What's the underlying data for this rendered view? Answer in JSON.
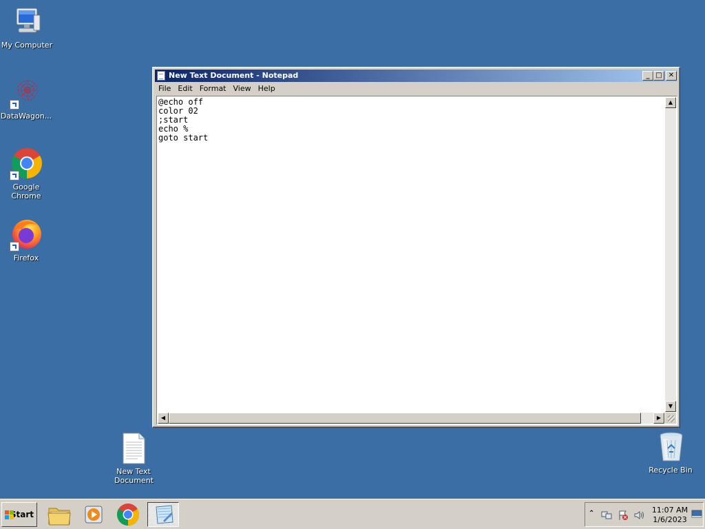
{
  "desktop": {
    "icons": [
      {
        "label": "My Computer"
      },
      {
        "label": "DataWagon..."
      },
      {
        "label": "Google Chrome"
      },
      {
        "label": "Firefox"
      },
      {
        "label": "New Text Document"
      },
      {
        "label": "Recycle Bin"
      }
    ]
  },
  "window": {
    "title": "New Text Document - Notepad",
    "controls": {
      "minimize": "_",
      "maximize": "□",
      "close": "✕"
    },
    "menu": [
      "File",
      "Edit",
      "Format",
      "View",
      "Help"
    ],
    "content": "@echo off\ncolor 02\n;start\necho %\ngoto start"
  },
  "taskbar": {
    "start_label": "Start",
    "clock_time": "11:07 AM",
    "clock_date": "1/6/2023"
  },
  "colors": {
    "desktop": "#3a6ea5",
    "title_start": "#0a246a",
    "title_end": "#a6caf0",
    "chrome_red": "#db4437",
    "chrome_yellow": "#f4b400",
    "chrome_green": "#0f9d58",
    "chrome_blue": "#4285f4"
  }
}
